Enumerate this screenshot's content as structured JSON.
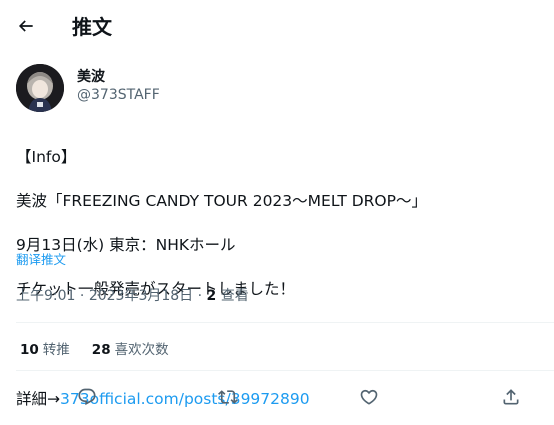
{
  "header": {
    "title": "推文"
  },
  "author": {
    "name": "美波",
    "handle": "@373STAFF"
  },
  "tweet": {
    "lines": [
      "【Info】",
      "美波「FREEZING CANDY TOUR 2023〜MELT DROP〜」",
      "9月13日(水) 東京：NHKホール",
      "チケット一般発売がスタートしました！",
      ""
    ],
    "link_prefix": "詳細→",
    "link_text": "373official.com/posts/39972890",
    "translate_label": "翻译推文"
  },
  "meta": {
    "time": "上午9:01",
    "date": "2023年3月18日",
    "views_count": "2",
    "views_label": "查看"
  },
  "stats": {
    "retweets_count": "10",
    "retweets_label": "转推",
    "likes_count": "28",
    "likes_label": "喜欢次数"
  },
  "colors": {
    "accent": "#1d9bf0",
    "secondary_text": "#536471",
    "divider": "#eff3f4"
  },
  "icons": {
    "back": "arrow-left-icon",
    "reply": "reply-icon",
    "retweet": "retweet-icon",
    "like": "heart-icon",
    "share": "share-icon"
  }
}
